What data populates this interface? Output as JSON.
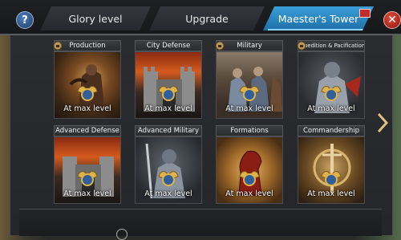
{
  "tabs": [
    {
      "label": "Glory level",
      "active": false
    },
    {
      "label": "Upgrade",
      "active": false
    },
    {
      "label": "Maester's Tower",
      "active": true
    }
  ],
  "buttons": {
    "help": "?",
    "close": "✕"
  },
  "cards": [
    {
      "title": "Production",
      "status": "At max level",
      "theme": "production",
      "icon": "gear-lock-icon"
    },
    {
      "title": "City Defense",
      "status": "At max level",
      "theme": "castle"
    },
    {
      "title": "Military",
      "status": "At max level",
      "theme": "military",
      "icon": "gear-lock-icon"
    },
    {
      "title": "Expedition & Pacification",
      "status": "At max level",
      "theme": "knight",
      "icon": "gear-lock-icon"
    },
    {
      "title": "Advanced Defense",
      "status": "At max level",
      "theme": "castle"
    },
    {
      "title": "Advanced Military",
      "status": "At max level",
      "theme": "armor"
    },
    {
      "title": "Formations",
      "status": "At max level",
      "theme": "formations"
    },
    {
      "title": "Commandership",
      "status": "At max level",
      "theme": "commander"
    }
  ],
  "colors": {
    "active_tab": "#2a8bd0",
    "medal_gold": "#e0b24a",
    "close_red": "#c0302a"
  }
}
